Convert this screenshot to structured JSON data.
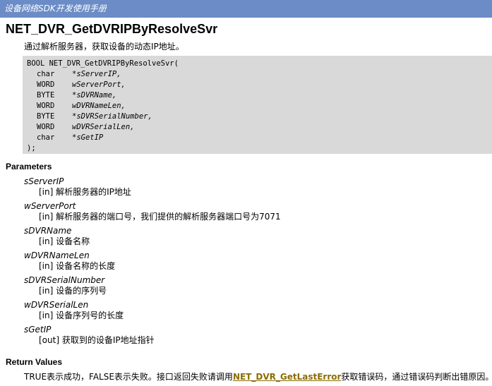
{
  "header": {
    "text": "设备网络SDK开发使用手册"
  },
  "title": "NET_DVR_GetDVRIPByResolveSvr",
  "summary": "通过解析服务器，获取设备的动态IP地址。",
  "code": {
    "open": "BOOL NET_DVR_GetDVRIPByResolveSvr(",
    "params": [
      {
        "type": "char",
        "name": "*sServerIP,"
      },
      {
        "type": "WORD",
        "name": "wServerPort,"
      },
      {
        "type": "BYTE",
        "name": "*sDVRName,"
      },
      {
        "type": "WORD",
        "name": "wDVRNameLen,"
      },
      {
        "type": "BYTE",
        "name": "*sDVRSerialNumber,"
      },
      {
        "type": "WORD",
        "name": "wDVRSerialLen,"
      },
      {
        "type": "char",
        "name": "*sGetIP"
      }
    ],
    "close": ");"
  },
  "parameters": {
    "heading": "Parameters",
    "items": [
      {
        "name": "sServerIP",
        "desc": "[in] 解析服务器的IP地址"
      },
      {
        "name": "wServerPort",
        "desc": "[in] 解析服务器的端口号，我们提供的解析服务器端口号为7071"
      },
      {
        "name": "sDVRName",
        "desc": "[in] 设备名称"
      },
      {
        "name": "wDVRNameLen",
        "desc": "[in] 设备名称的长度"
      },
      {
        "name": "sDVRSerialNumber",
        "desc": "[in] 设备的序列号"
      },
      {
        "name": "wDVRSerialLen",
        "desc": "[in] 设备序列号的长度"
      },
      {
        "name": "sGetIP",
        "desc": "[out] 获取到的设备IP地址指针"
      }
    ]
  },
  "return_values": {
    "heading": "Return Values",
    "text_before": "TRUE表示成功，FALSE表示失败。接口返回失败请调用",
    "link": "NET_DVR_GetLastError",
    "text_after": "获取错误码，通过错误码判断出错原因。"
  },
  "colors": {
    "header_bg": "#6b8cc6",
    "code_bg": "#d9d9d9",
    "link": "#8a6d00"
  }
}
